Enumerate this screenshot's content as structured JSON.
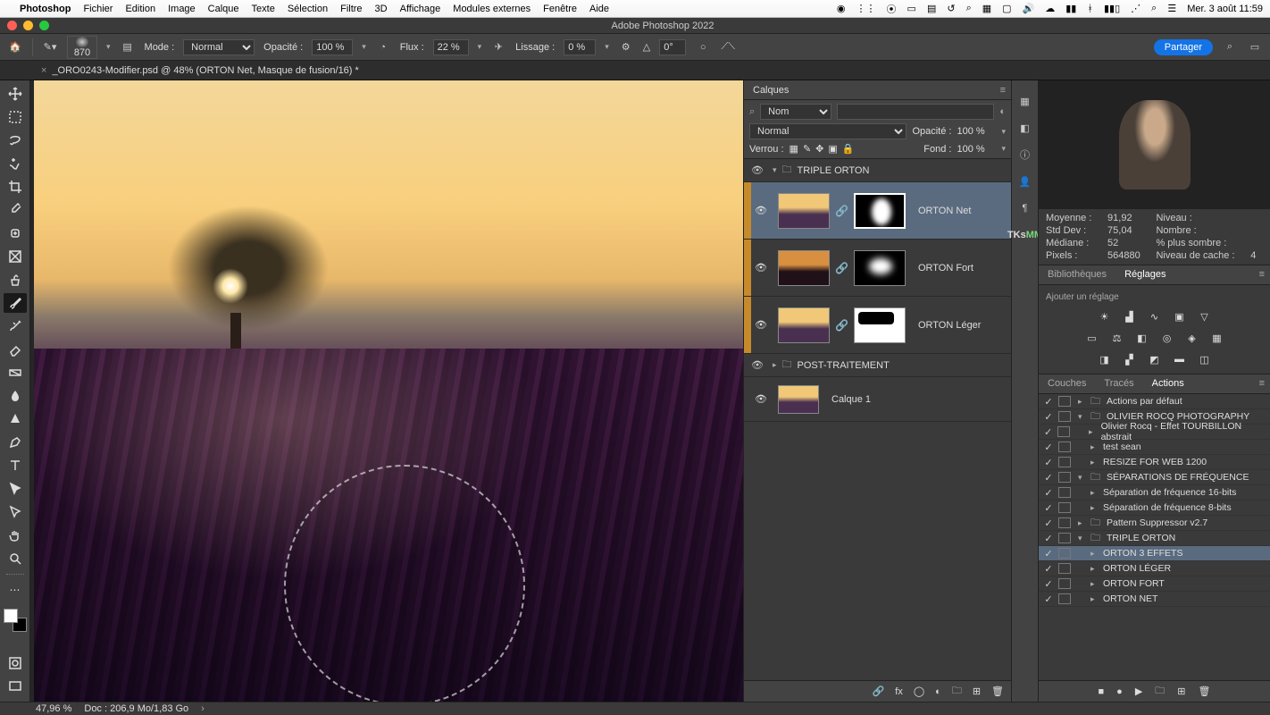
{
  "mac_menu": {
    "app": "Photoshop",
    "items": [
      "Fichier",
      "Edition",
      "Image",
      "Calque",
      "Texte",
      "Sélection",
      "Filtre",
      "3D",
      "Affichage",
      "Modules externes",
      "Fenêtre",
      "Aide"
    ],
    "clock": "Mer. 3 août  11:59"
  },
  "titlebar": {
    "title": "Adobe Photoshop 2022"
  },
  "options": {
    "brush_size": "870",
    "mode_label": "Mode :",
    "mode_value": "Normal",
    "opacity_label": "Opacité :",
    "opacity_value": "100 %",
    "flux_label": "Flux :",
    "flux_value": "22 %",
    "lissage_label": "Lissage :",
    "lissage_value": "0 %",
    "angle_label": "△",
    "angle_value": "0°",
    "share": "Partager"
  },
  "doc_tab": "_ORO0243-Modifier.psd @ 48% (ORTON Net, Masque de fusion/16) *",
  "layers_panel": {
    "title": "Calques",
    "kind_label": "Nom",
    "blend_mode": "Normal",
    "opacity_label": "Opacité :",
    "opacity_value": "100 %",
    "lock_label": "Verrou :",
    "fill_label": "Fond :",
    "fill_value": "100 %",
    "groups": [
      {
        "name": "TRIPLE ORTON",
        "expanded": true,
        "layers": [
          {
            "name": "ORTON Net",
            "selected": true
          },
          {
            "name": "ORTON Fort"
          },
          {
            "name": "ORTON Léger"
          }
        ]
      },
      {
        "name": "POST-TRAITEMENT",
        "expanded": false
      }
    ],
    "bg_layer": "Calque 1"
  },
  "histogram": {
    "stats": {
      "moyenne_l": "Moyenne :",
      "moyenne_v": "91,92",
      "niveau_l": "Niveau :",
      "niveau_v": "",
      "stddev_l": "Std Dev :",
      "stddev_v": "75,04",
      "nombre_l": "Nombre :",
      "nombre_v": "",
      "mediane_l": "Médiane :",
      "mediane_v": "52",
      "plus_sombre_l": "% plus sombre :",
      "plus_sombre_v": "",
      "pixels_l": "Pixels :",
      "pixels_v": "564880",
      "cache_l": "Niveau de cache :",
      "cache_v": "4"
    }
  },
  "right_tabs": {
    "biblio": "Bibliothèques",
    "reglages": "Réglages",
    "ajouter": "Ajouter un réglage"
  },
  "actions_panel": {
    "tabs": [
      "Couches",
      "Tracés",
      "Actions"
    ],
    "rows": [
      {
        "indent": 0,
        "folder": true,
        "open": false,
        "label": "Actions par défaut"
      },
      {
        "indent": 0,
        "folder": true,
        "open": true,
        "label": "OLIVIER ROCQ PHOTOGRAPHY"
      },
      {
        "indent": 1,
        "label": "Olivier Rocq - Effet TOURBILLON abstrait"
      },
      {
        "indent": 1,
        "label": "test sean"
      },
      {
        "indent": 1,
        "label": "RESIZE FOR WEB 1200"
      },
      {
        "indent": 0,
        "folder": true,
        "open": true,
        "label": "SÉPARATIONS DE FRÉQUENCE"
      },
      {
        "indent": 1,
        "label": "Séparation de fréquence 16-bits"
      },
      {
        "indent": 1,
        "label": "Séparation de fréquence 8-bits"
      },
      {
        "indent": 0,
        "folder": true,
        "open": false,
        "label": "Pattern Suppressor v2.7"
      },
      {
        "indent": 0,
        "folder": true,
        "open": true,
        "label": "TRIPLE ORTON"
      },
      {
        "indent": 1,
        "selected": true,
        "label": "ORTON 3 EFFETS"
      },
      {
        "indent": 1,
        "label": "ORTON LÉGER"
      },
      {
        "indent": 1,
        "label": "ORTON FORT"
      },
      {
        "indent": 1,
        "label": "ORTON NET"
      }
    ]
  },
  "icon_strip_badge": "TKs",
  "icon_strip_badge2": "MM",
  "status": {
    "zoom": "47,96 %",
    "doc": "Doc : 206,9 Mo/1,83 Go"
  }
}
